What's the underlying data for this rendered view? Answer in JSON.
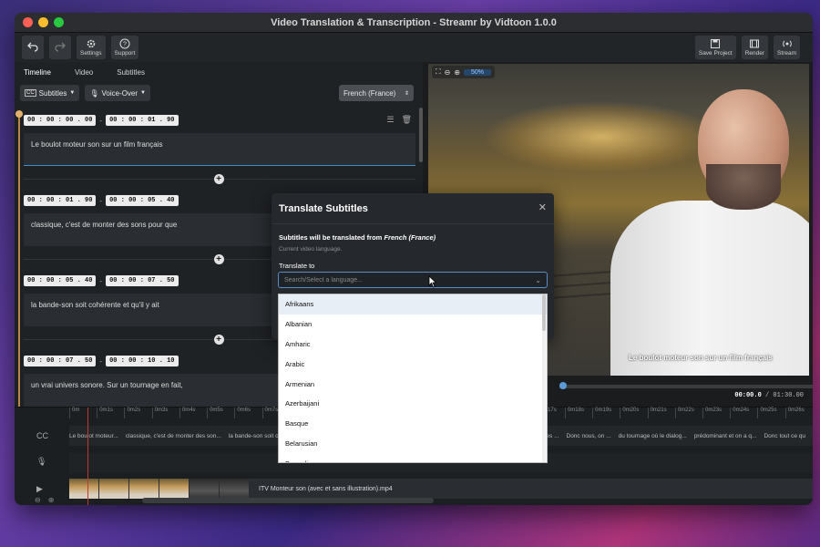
{
  "window": {
    "title": "Video Translation & Transcription - Streamr by Vidtoon 1.0.0"
  },
  "toolbar": {
    "settings_label": "Settings",
    "support_label": "Support",
    "save_label": "Save Project",
    "render_label": "Render",
    "stream_label": "Stream"
  },
  "tabs": [
    {
      "label": "Timeline"
    },
    {
      "label": "Video"
    },
    {
      "label": "Subtitles"
    }
  ],
  "subbar": {
    "subtitles_dd": "Subtitles",
    "voiceover_dd": "Voice-Over",
    "language": "French (France)"
  },
  "segments": [
    {
      "start": "00 : 00 : 00 . 00",
      "end": "00 : 00 : 01 . 90",
      "text": "Le boulot moteur son sur un film français"
    },
    {
      "start": "00 : 00 : 01 . 90",
      "end": "00 : 00 : 05 . 40",
      "text": "classique, c'est de monter des sons pour que"
    },
    {
      "start": "00 : 00 : 05 . 40",
      "end": "00 : 00 : 07 . 50",
      "text": "la bande-son soit cohérente et qu'il y ait"
    },
    {
      "start": "00 : 00 : 07 . 50",
      "end": "00 : 00 : 10 . 10",
      "text": "un vrai univers sonore. Sur un tournage en fait,"
    }
  ],
  "preview": {
    "zoom_pct": "50%",
    "caption": "Le boulot moteur son sur un film français",
    "current_time": "00:00.0",
    "total_time": "/ 01:30.00"
  },
  "timeline": {
    "ruler": [
      "0m",
      "0m1s",
      "0m2s",
      "0m3s",
      "0m4s",
      "0m5s",
      "0m6s",
      "0m7s",
      "0m8s",
      "0m9s",
      "0m10s",
      "0m11s",
      "0m12s",
      "0m13s",
      "0m14s",
      "0m15s",
      "0m16s",
      "0m17s",
      "0m18s",
      "0m19s",
      "0m20s",
      "0m21s",
      "0m22s",
      "0m23s",
      "0m24s",
      "0m25s",
      "0m26s"
    ],
    "subclips": [
      "Le boulot moteur...",
      "classique, c'est de monter des son...",
      "la bande-son soit c...",
      "",
      "",
      "",
      "",
      "",
      "",
      "ous les ...",
      "Donc nous, on ...",
      "du tournage où le dialog...",
      "prédominant et on a q...",
      "Donc tout ce qu"
    ],
    "video_name": "ITV Monteur son (avec et sans illustration).mp4"
  },
  "modal": {
    "title": "Translate Subtitles",
    "from_prefix": "Subtitles will be translated from",
    "from_lang": "French (France)",
    "hint": "Current video language.",
    "to_label": "Translate to",
    "placeholder": "Search/Select a language..."
  },
  "languages": [
    "Afrikaans",
    "Albanian",
    "Amharic",
    "Arabic",
    "Armenian",
    "Azerbaijani",
    "Basque",
    "Belarusian",
    "Bengali"
  ]
}
